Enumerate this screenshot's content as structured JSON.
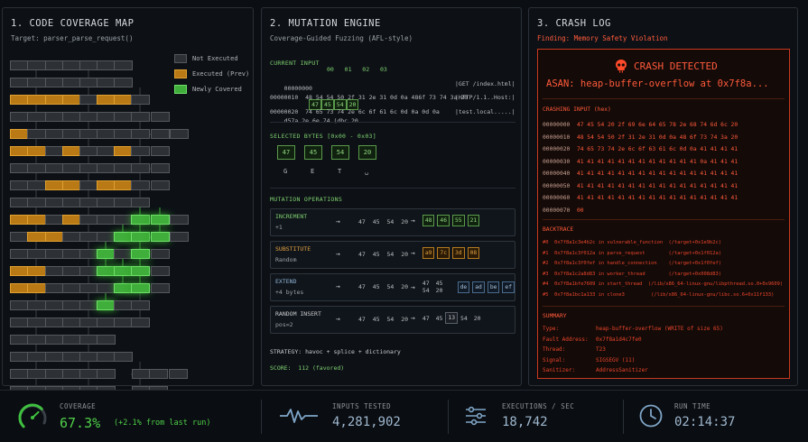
{
  "coverage_map": {
    "title": "1. CODE COVERAGE MAP",
    "target": "Target: parser_parse_request()",
    "legend": [
      {
        "label": "Not Executed",
        "state": "not"
      },
      {
        "label": "Executed (Prev)",
        "state": "ex"
      },
      {
        "label": "Newly Covered",
        "state": "nc"
      }
    ],
    "colors": {
      "not": "#2d3035",
      "executed": "#b97a16",
      "new": "#3fae3a"
    }
  },
  "mutation": {
    "title": "2. MUTATION ENGINE",
    "subtitle": "Coverage-Guided Fuzzing (AFL-style)",
    "current_input_label": "CURRENT INPUT",
    "col_header": "00  01  02  03",
    "rows": [
      {
        "addr": "00000000",
        "selected": [
          "47",
          "45",
          "54",
          "20"
        ],
        "rest": "d57a 2e 6e 74 (dbc 20",
        "ascii": "|GET /index.html|"
      },
      {
        "addr": "00000010",
        "hex": "48 54 54 50 2f 31 2e 31 0d 0a 486f 73 74 3a 20",
        "ascii": "|HTTP/1.1..Host:|"
      },
      {
        "addr": "00000020",
        "hex": "74 65 73 74 2e 6c 6f 61 6c 0d 0a 0d 0a",
        "ascii": "|test.local.....|"
      }
    ],
    "selected_label": "SELECTED BYTES [0x00 - 0x03]",
    "selected_bytes": [
      {
        "hex": "47",
        "ch": "G"
      },
      {
        "hex": "45",
        "ch": "E"
      },
      {
        "hex": "54",
        "ch": "T"
      },
      {
        "hex": "20",
        "ch": "␣"
      }
    ],
    "ops_label": "MUTATION OPERATIONS",
    "ops": [
      {
        "name": "INCREMENT",
        "sub": "+1",
        "before": "47 45 54 20",
        "after": [
          "48",
          "46",
          "55",
          "21"
        ],
        "style": "bg",
        "name_color": "#7fd16f"
      },
      {
        "name": "SUBSTITUTE",
        "sub": "Random",
        "before": "47 45 54 20",
        "after": [
          "a9",
          "7c",
          "3d",
          "08"
        ],
        "style": "bo",
        "name_color": "#e0a040"
      },
      {
        "name": "EXTEND",
        "sub": "+4 bytes",
        "before": "47 45 54 20",
        "after_prefix": "47 45 54 20",
        "after": [
          "de",
          "ad",
          "be",
          "ef"
        ],
        "style": "bb",
        "name_color": "#8fb4d8"
      },
      {
        "name": "RANDOM INSERT",
        "sub": "pos=2",
        "before": "47 45 54 20",
        "after_prefix": "47 45",
        "after": [
          "13"
        ],
        "after_suffix": "54 20",
        "style": "bw",
        "name_color": "#c8ccd0"
      }
    ],
    "strategy": "STRATEGY: havoc + splice + dictionary",
    "score": "SCORE:  112 (favored)"
  },
  "crash": {
    "title": "3. CRASH LOG",
    "finding": "Finding: Memory Safety Violation",
    "headline": "CRASH DETECTED",
    "asan": "ASAN: heap-buffer-overflow at 0x7f8a...",
    "crashing_input_label": "CRASHING INPUT (hex)",
    "hex_rows": [
      {
        "addr": "00000000",
        "hex": "47 45 54 20 2f 69 6e 64 65 78 2e 68 74 6d 6c 20"
      },
      {
        "addr": "00000010",
        "hex": "48 54 54 50 2f 31 2e 31 0d 0a 48 6f 73 74 3a 20"
      },
      {
        "addr": "00000020",
        "hex": "74 65 73 74 2e 6c 6f 63 61 6c 0d 0a 41 41 41 41"
      },
      {
        "addr": "00000030",
        "hex": "41 41 41 41 41 41 41 41 41 41 41 41 0a 41 41 41"
      },
      {
        "addr": "00000040",
        "hex": "41 41 41 41 41 41 41 41 41 41 41 41 41 41 41 41"
      },
      {
        "addr": "00000050",
        "hex": "41 41 41 41 41 41 41 41 41 41 41 41 41 41 41 41"
      },
      {
        "addr": "00000060",
        "hex": "41 41 41 41 41 41 41 41 41 41 41 41 41 41 41 41"
      },
      {
        "addr": "00000070",
        "hex": "00"
      }
    ],
    "backtrace_label": "BACKTRACE",
    "backtrace": [
      "#0  0x7f8a1c3e4b2c in vulnerable_function  (/target+0x1e9b2c)",
      "#1  0x7f8a1c3f012a in parse_request        (/target+0x1f012a)",
      "#2  0x7f8a1c3f0fef in handle_connection    (/target+0x1f0fef)",
      "#3  0x7f8a1c2a8d83 in worker_thread        (/target+0x008d83)",
      "#4  0x7f8a1bfe7609 in start_thread  (/lib/x86_64-linux-gnu/libpthread.so.0+0x9609)",
      "#5  0x7f8a1bc1a133 in clone3         (/lib/x86_64-linux-gnu/libc.so.6+0x11f133)"
    ],
    "summary_label": "SUMMARY",
    "summary": [
      {
        "k": "Type:",
        "v": "heap-buffer-overflow (WRITE of size 65)"
      },
      {
        "k": "Fault Address:",
        "v": "0x7f8a1d4c7fe0"
      },
      {
        "k": "Thread:",
        "v": "T23"
      },
      {
        "k": "Signal:",
        "v": "SIGSEGV (11)"
      },
      {
        "k": "Sanitizer:",
        "v": "AddressSanitizer"
      }
    ]
  },
  "stats": {
    "coverage_label": "COVERAGE",
    "coverage_value": "67.3%",
    "coverage_delta": "(+2.1% from last run)",
    "coverage_fraction": 0.673,
    "inputs_label": "INPUTS TESTED",
    "inputs_value": "4,281,902",
    "eps_label": "EXECUTIONS / SEC",
    "eps_value": "18,742",
    "runtime_label": "RUN TIME",
    "runtime_value": "02:14:37"
  }
}
